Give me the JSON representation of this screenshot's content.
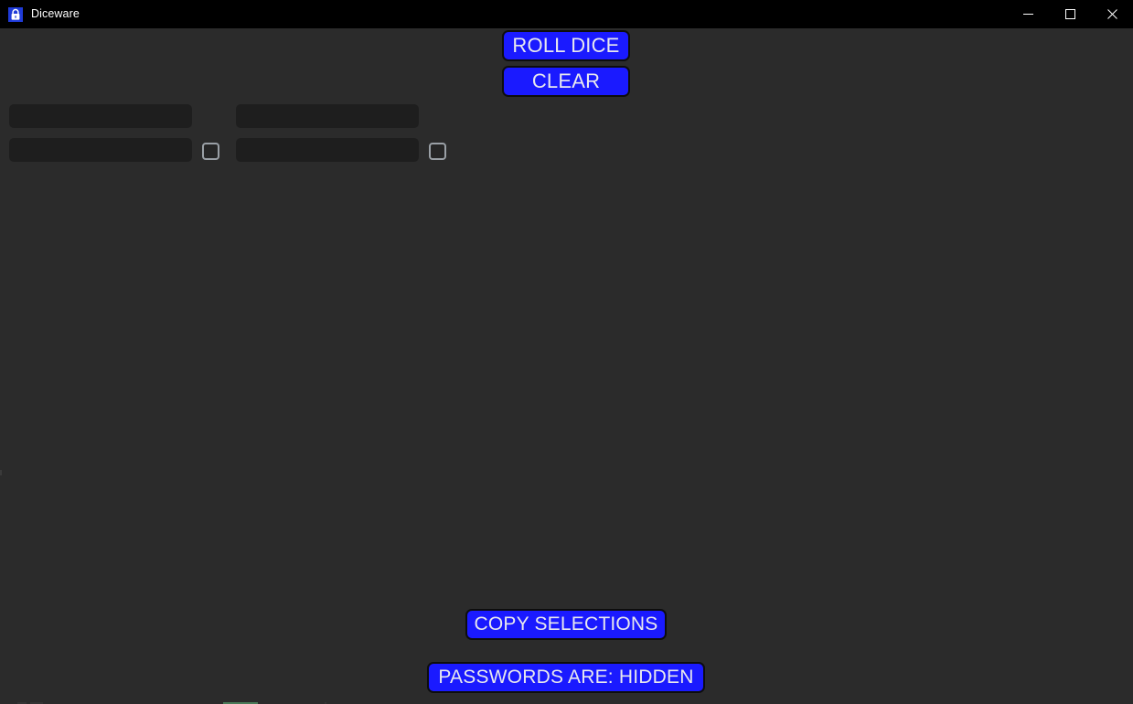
{
  "window": {
    "title": "Diceware",
    "icon": "padlock-icon",
    "background_color": "#2b2b2b",
    "titlebar_color": "#000000",
    "controls": {
      "minimize": "minimize-icon",
      "maximize": "maximize-icon",
      "close": "close-icon"
    }
  },
  "theme": {
    "accent_color": "#1a1aff",
    "button_text_color": "#e8e8ee",
    "field_color": "#1e1e1e",
    "checkbox_border_color": "#9aa0a6"
  },
  "toolbar": {
    "roll_dice_label": "ROLL DICE",
    "clear_label": "CLEAR"
  },
  "word_rows": [
    {
      "roll_result": "",
      "roll_result_placeholder": "",
      "word": "",
      "word_placeholder": "",
      "checked": false
    },
    {
      "roll_result": "",
      "roll_result_placeholder": "",
      "word": "",
      "word_placeholder": "",
      "checked": false
    }
  ],
  "footer": {
    "copy_selections_label": "COPY SELECTIONS",
    "passwords_visibility_label": "PASSWORDS ARE: HIDDEN"
  }
}
